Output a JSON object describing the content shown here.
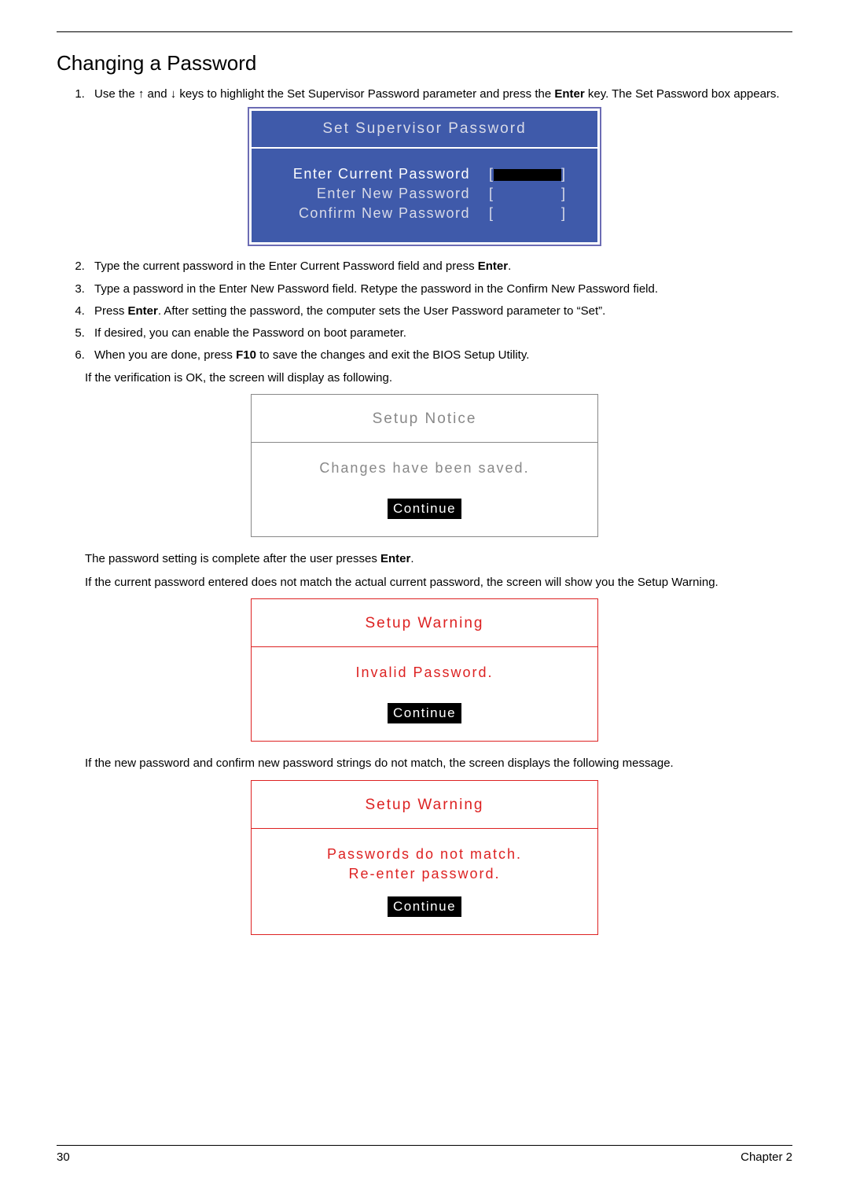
{
  "heading": "Changing a Password",
  "steps": {
    "s1a": "Use the ",
    "s1b": " and ",
    "s1c": " keys to highlight the Set Supervisor Password parameter and press the ",
    "s1d": " key. The Set Password box appears.",
    "s2a": "Type the current password in the Enter Current Password field and press ",
    "s2b": ".",
    "s3": "Type a password in the Enter New Password field. Retype the password in the Confirm New Password field.",
    "s4a": "Press ",
    "s4b": ". After setting the password, the computer sets the User Password parameter to “Set”.",
    "s5": "If desired, you can enable the Password on boot parameter.",
    "s6a": "When you are done, press ",
    "s6b": " to save the changes and exit the BIOS Setup Utility."
  },
  "keys": {
    "up": "↑",
    "down": "↓",
    "enter": "Enter",
    "f10": "F10"
  },
  "bios": {
    "title": "Set Supervisor Password",
    "row1": "Enter Current Password",
    "row2": "Enter New Password",
    "row3": "Confirm New Password",
    "bracketL": "[",
    "bracketR": "]"
  },
  "para1": "If the verification is OK, the screen will display as following.",
  "notice": {
    "title": "Setup Notice",
    "msg": "Changes have been saved.",
    "button": "Continue"
  },
  "para2a": "The password setting is complete after the user presses ",
  "para2b": ".",
  "para3": "If the current password entered does not match the actual current password, the screen will show you the Setup Warning.",
  "warn1": {
    "title": "Setup Warning",
    "msg": "Invalid Password.",
    "button": "Continue"
  },
  "para4": "If the new password and confirm new password strings do not match, the screen displays the following message.",
  "warn2": {
    "title": "Setup Warning",
    "msg1": "Passwords do not match.",
    "msg2": "Re-enter password.",
    "button": "Continue"
  },
  "footer": {
    "pageno": "30",
    "chapter": "Chapter 2"
  }
}
